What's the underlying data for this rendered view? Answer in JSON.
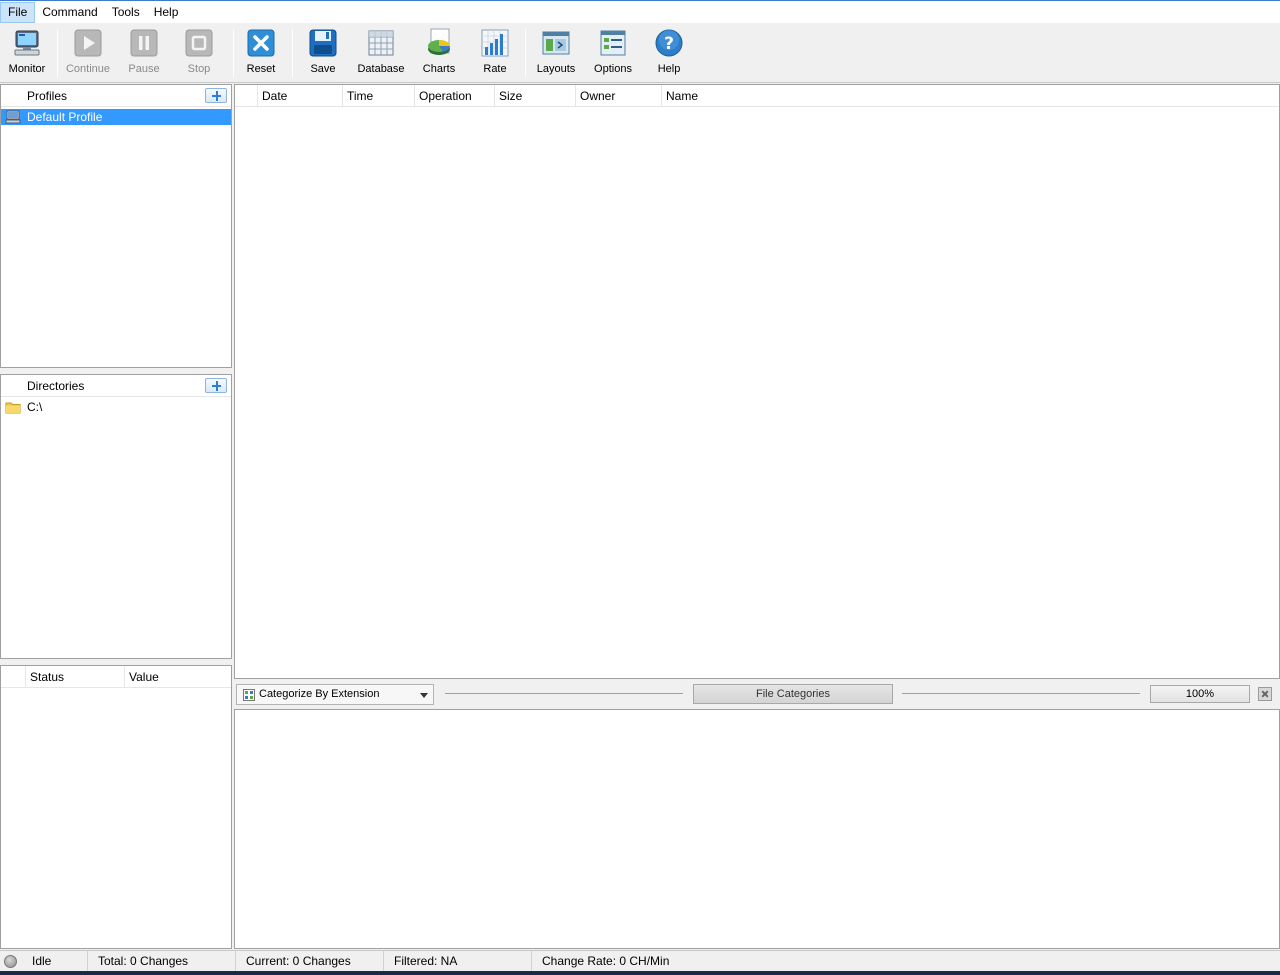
{
  "menu": {
    "items": [
      "File",
      "Command",
      "Tools",
      "Help"
    ]
  },
  "toolbar": {
    "monitor": "Monitor",
    "continue": "Continue",
    "pause": "Pause",
    "stop": "Stop",
    "reset": "Reset",
    "save": "Save",
    "database": "Database",
    "charts": "Charts",
    "rate": "Rate",
    "layouts": "Layouts",
    "options": "Options",
    "help": "Help"
  },
  "profiles": {
    "header": "Profiles",
    "items": [
      "Default Profile"
    ]
  },
  "directories": {
    "header": "Directories",
    "items": [
      "C:\\"
    ]
  },
  "status_panel": {
    "columns": [
      "Status",
      "Value"
    ]
  },
  "events_grid": {
    "columns": [
      "Date",
      "Time",
      "Operation",
      "Size",
      "Owner",
      "Name"
    ]
  },
  "categories": {
    "selector": "Categorize By Extension",
    "title": "File Categories",
    "zoom": "100%"
  },
  "statusbar": {
    "state": "Idle",
    "total": "Total: 0 Changes",
    "current": "Current: 0 Changes",
    "filtered": "Filtered: NA",
    "rate": "Change Rate: 0 CH/Min"
  },
  "colors": {
    "selection": "#3399ff",
    "accent": "#2a7fd4",
    "folder": "#f2c94c"
  }
}
